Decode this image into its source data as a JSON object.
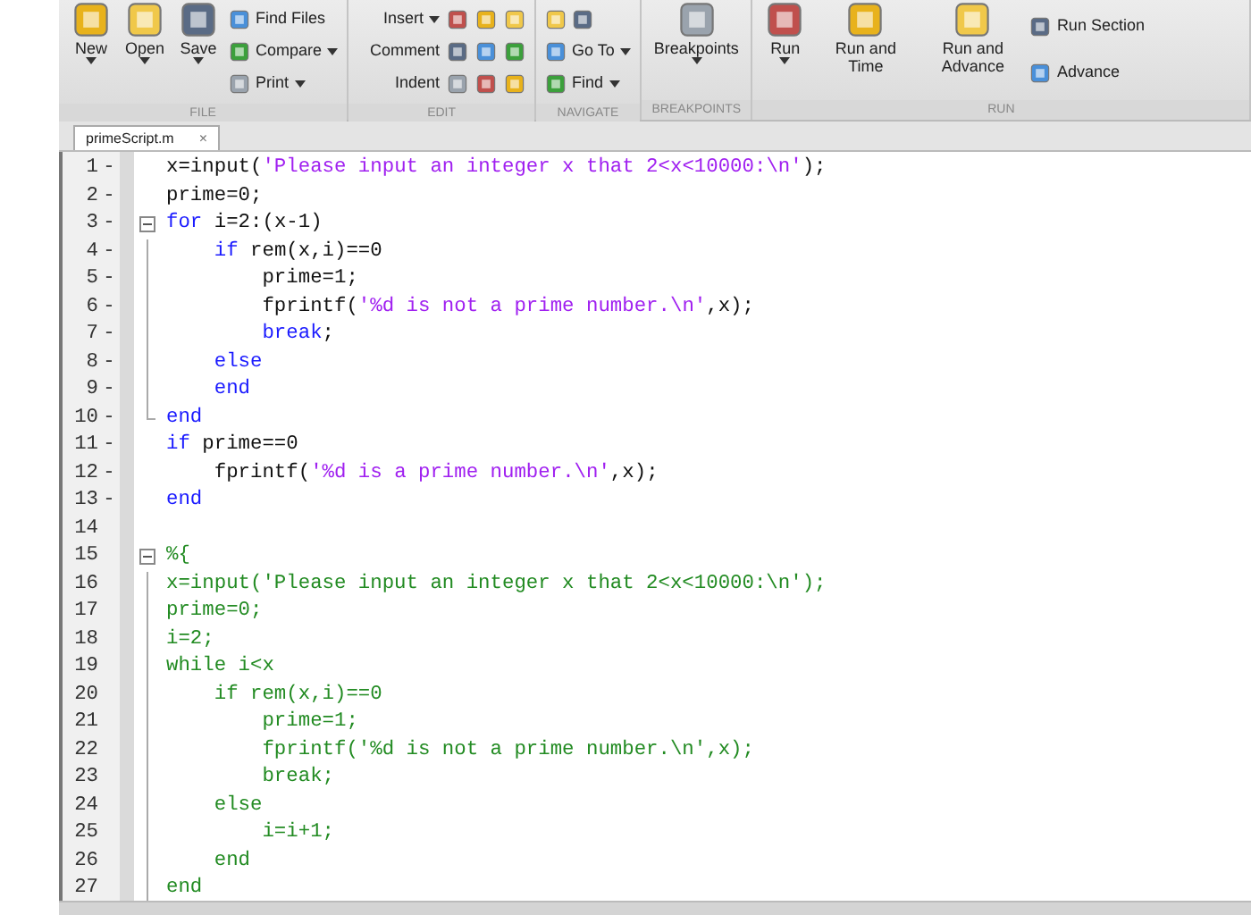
{
  "toolbar": {
    "sections": [
      {
        "label": "FILE",
        "columns": [
          {
            "kind": "large",
            "items": [
              {
                "label": "New",
                "dropdown": true
              }
            ]
          },
          {
            "kind": "large",
            "items": [
              {
                "label": "Open",
                "dropdown": true
              }
            ]
          },
          {
            "kind": "large",
            "items": [
              {
                "label": "Save",
                "dropdown": true
              }
            ]
          },
          {
            "kind": "small",
            "items": [
              {
                "label": "Find Files",
                "dropdown": false
              },
              {
                "label": "Compare",
                "dropdown": true
              },
              {
                "label": "Print",
                "dropdown": true
              }
            ]
          }
        ]
      },
      {
        "label": "EDIT",
        "columns": [
          {
            "kind": "iconrow",
            "items": [
              {
                "label": "Insert",
                "dropdown": true
              },
              {
                "label": "Comment",
                "dropdown": false
              },
              {
                "label": "Indent",
                "dropdown": false
              }
            ]
          }
        ]
      },
      {
        "label": "NAVIGATE",
        "columns": [
          {
            "kind": "small",
            "items": [
              {
                "dropdown": false
              },
              {
                "label": "Go To",
                "dropdown": true
              },
              {
                "label": "Find",
                "dropdown": true
              }
            ]
          }
        ]
      },
      {
        "label": "BREAKPOINTS",
        "columns": [
          {
            "kind": "large",
            "items": [
              {
                "label": "Breakpoints",
                "dropdown": true
              }
            ]
          }
        ]
      },
      {
        "label": "RUN",
        "columns": [
          {
            "kind": "large",
            "items": [
              {
                "label": "Run",
                "dropdown": true
              }
            ]
          },
          {
            "kind": "large",
            "items": [
              {
                "label": "Run and Time",
                "dropdown": false
              }
            ]
          },
          {
            "kind": "large",
            "items": [
              {
                "label": "Run and Advance",
                "dropdown": false
              }
            ]
          },
          {
            "kind": "small",
            "items": [
              {
                "label": "Run Section",
                "dropdown": false
              },
              {
                "label": "Advance",
                "dropdown": false
              }
            ]
          }
        ]
      }
    ]
  },
  "tabs": [
    {
      "label": "primeScript.m",
      "close": "×",
      "selected": true
    }
  ],
  "editor": {
    "lines": [
      {
        "number": "1",
        "marker": "-",
        "fold_toggle": false,
        "fold_guide": false,
        "fold_end": false,
        "segments": [
          {
            "kind": "code",
            "text": "x=input("
          },
          {
            "kind": "string",
            "text": "'Please input an integer x that 2<x<10000:\\n'"
          },
          {
            "kind": "code",
            "text": ");"
          }
        ]
      },
      {
        "number": "2",
        "marker": "-",
        "fold_toggle": false,
        "fold_guide": false,
        "fold_end": false,
        "segments": [
          {
            "kind": "code",
            "text": "prime=0;"
          }
        ]
      },
      {
        "number": "3",
        "marker": "-",
        "fold_toggle": true,
        "fold_guide": false,
        "fold_end": false,
        "segments": [
          {
            "kind": "keyword",
            "text": "for"
          },
          {
            "kind": "code",
            "text": " i=2:(x-1)"
          }
        ]
      },
      {
        "number": "4",
        "marker": "-",
        "fold_toggle": false,
        "fold_guide": true,
        "fold_end": false,
        "segments": [
          {
            "kind": "keyword",
            "text": "    if"
          },
          {
            "kind": "code",
            "text": " rem(x,i)==0"
          }
        ]
      },
      {
        "number": "5",
        "marker": "-",
        "fold_toggle": false,
        "fold_guide": true,
        "fold_end": false,
        "segments": [
          {
            "kind": "code",
            "text": "        prime=1;"
          }
        ]
      },
      {
        "number": "6",
        "marker": "-",
        "fold_toggle": false,
        "fold_guide": true,
        "fold_end": false,
        "segments": [
          {
            "kind": "code",
            "text": "        fprintf("
          },
          {
            "kind": "string",
            "text": "'%d is not a prime number.\\n'"
          },
          {
            "kind": "code",
            "text": ",x);"
          }
        ]
      },
      {
        "number": "7",
        "marker": "-",
        "fold_toggle": false,
        "fold_guide": true,
        "fold_end": false,
        "segments": [
          {
            "kind": "keyword",
            "text": "        break"
          },
          {
            "kind": "code",
            "text": ";"
          }
        ]
      },
      {
        "number": "8",
        "marker": "-",
        "fold_toggle": false,
        "fold_guide": true,
        "fold_end": false,
        "segments": [
          {
            "kind": "keyword",
            "text": "    else"
          }
        ]
      },
      {
        "number": "9",
        "marker": "-",
        "fold_toggle": false,
        "fold_guide": true,
        "fold_end": false,
        "segments": [
          {
            "kind": "keyword",
            "text": "    end"
          }
        ]
      },
      {
        "number": "10",
        "marker": "-",
        "fold_toggle": false,
        "fold_guide": false,
        "fold_end": true,
        "segments": [
          {
            "kind": "keyword",
            "text": "end"
          }
        ]
      },
      {
        "number": "11",
        "marker": "-",
        "fold_toggle": false,
        "fold_guide": false,
        "fold_end": false,
        "segments": [
          {
            "kind": "keyword",
            "text": "if"
          },
          {
            "kind": "code",
            "text": " prime==0"
          }
        ]
      },
      {
        "number": "12",
        "marker": "-",
        "fold_toggle": false,
        "fold_guide": false,
        "fold_end": false,
        "segments": [
          {
            "kind": "code",
            "text": "    fprintf("
          },
          {
            "kind": "string",
            "text": "'%d is a prime number.\\n'"
          },
          {
            "kind": "code",
            "text": ",x);"
          }
        ]
      },
      {
        "number": "13",
        "marker": "-",
        "fold_toggle": false,
        "fold_guide": false,
        "fold_end": false,
        "segments": [
          {
            "kind": "keyword",
            "text": "end"
          }
        ]
      },
      {
        "number": "14",
        "fold_toggle": false,
        "fold_guide": false,
        "fold_end": false
      },
      {
        "number": "15",
        "fold_toggle": true,
        "fold_guide": false,
        "fold_end": false,
        "segments": [
          {
            "kind": "comment",
            "text": "%{"
          }
        ]
      },
      {
        "number": "16",
        "fold_toggle": false,
        "fold_guide": true,
        "fold_end": false,
        "segments": [
          {
            "kind": "comment",
            "text": "x=input('Please input an integer x that 2<x<10000:\\n');"
          }
        ]
      },
      {
        "number": "17",
        "fold_toggle": false,
        "fold_guide": true,
        "fold_end": false,
        "segments": [
          {
            "kind": "comment",
            "text": "prime=0;"
          }
        ]
      },
      {
        "number": "18",
        "fold_toggle": false,
        "fold_guide": true,
        "fold_end": false,
        "segments": [
          {
            "kind": "comment",
            "text": "i=2;"
          }
        ]
      },
      {
        "number": "19",
        "fold_toggle": false,
        "fold_guide": true,
        "fold_end": false,
        "segments": [
          {
            "kind": "comment",
            "text": "while i<x"
          }
        ]
      },
      {
        "number": "20",
        "fold_toggle": false,
        "fold_guide": true,
        "fold_end": false,
        "segments": [
          {
            "kind": "comment",
            "text": "    if rem(x,i)==0"
          }
        ]
      },
      {
        "number": "21",
        "fold_toggle": false,
        "fold_guide": true,
        "fold_end": false,
        "segments": [
          {
            "kind": "comment",
            "text": "        prime=1;"
          }
        ]
      },
      {
        "number": "22",
        "fold_toggle": false,
        "fold_guide": true,
        "fold_end": false,
        "segments": [
          {
            "kind": "comment",
            "text": "        fprintf('%d is not a prime number.\\n',x);"
          }
        ]
      },
      {
        "number": "23",
        "fold_toggle": false,
        "fold_guide": true,
        "fold_end": false,
        "segments": [
          {
            "kind": "comment",
            "text": "        break;"
          }
        ]
      },
      {
        "number": "24",
        "fold_toggle": false,
        "fold_guide": true,
        "fold_end": false,
        "segments": [
          {
            "kind": "comment",
            "text": "    else"
          }
        ]
      },
      {
        "number": "25",
        "fold_toggle": false,
        "fold_guide": true,
        "fold_end": false,
        "segments": [
          {
            "kind": "comment",
            "text": "        i=i+1;"
          }
        ]
      },
      {
        "number": "26",
        "fold_toggle": false,
        "fold_guide": true,
        "fold_end": false,
        "segments": [
          {
            "kind": "comment",
            "text": "    end"
          }
        ]
      },
      {
        "number": "27",
        "fold_toggle": false,
        "fold_guide": true,
        "fold_end": false,
        "segments": [
          {
            "kind": "comment",
            "text": "end"
          }
        ]
      }
    ]
  }
}
